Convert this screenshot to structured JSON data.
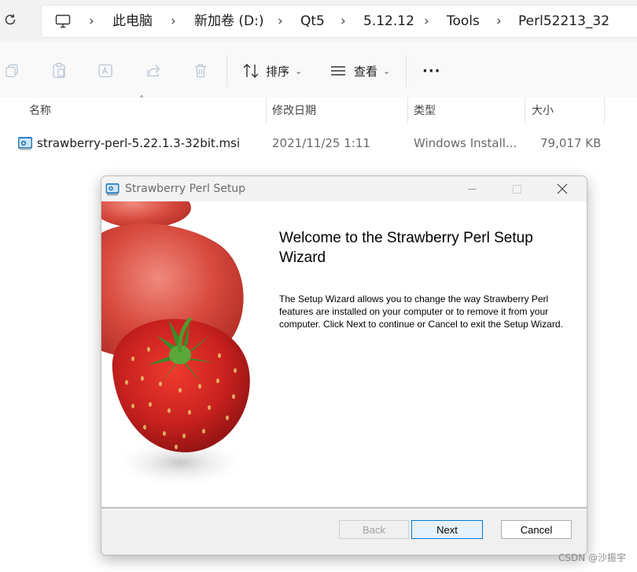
{
  "address_bar": {
    "crumbs": [
      "此电脑",
      "新加卷 (D:)",
      "Qt5",
      "5.12.12",
      "Tools",
      "Perl52213_32"
    ]
  },
  "toolbar": {
    "sort_label": "排序",
    "view_label": "查看",
    "more_label": "···"
  },
  "file_list": {
    "columns": [
      "名称",
      "修改日期",
      "类型",
      "大小"
    ],
    "rows": [
      {
        "name": "strawberry-perl-5.22.1.3-32bit.msi",
        "modified": "2021/11/25 1:11",
        "type": "Windows Install...",
        "size": "79,017 KB"
      }
    ]
  },
  "dialog": {
    "title": "Strawberry Perl Setup",
    "heading": "Welcome to the Strawberry Perl Setup Wizard",
    "description": "The Setup Wizard allows you to change the way Strawberry Perl features are installed on your computer or to remove it from your computer. Click Next to continue or Cancel to exit the Setup Wizard.",
    "buttons": {
      "back": "Back",
      "next": "Next",
      "cancel": "Cancel"
    }
  },
  "watermark": "CSDN @沙振宇",
  "colors": {
    "accent": "#0078d7",
    "strawberry": "#c8211f",
    "leaf": "#3d8a2a"
  }
}
